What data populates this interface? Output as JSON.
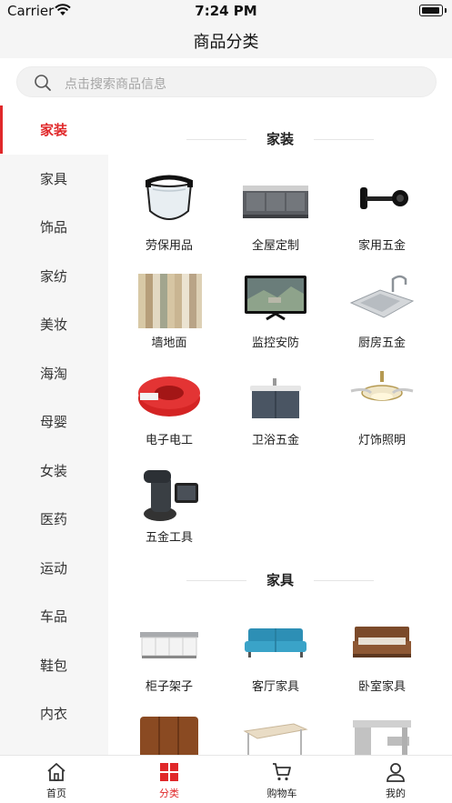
{
  "status_bar": {
    "carrier": "Carrier",
    "time": "7:24 PM"
  },
  "nav": {
    "title": "商品分类"
  },
  "search": {
    "placeholder": "点击搜索商品信息"
  },
  "accent_color": "#e0282a",
  "sidebar": {
    "active_index": 0,
    "items": [
      {
        "label": "家装"
      },
      {
        "label": "家具"
      },
      {
        "label": "饰品"
      },
      {
        "label": "家纺"
      },
      {
        "label": "美妆"
      },
      {
        "label": "海淘"
      },
      {
        "label": "母婴"
      },
      {
        "label": "女装"
      },
      {
        "label": "医药"
      },
      {
        "label": "运动"
      },
      {
        "label": "车品"
      },
      {
        "label": "鞋包"
      },
      {
        "label": "内衣"
      }
    ]
  },
  "sections": [
    {
      "title": "家装",
      "items": [
        {
          "label": "劳保用品",
          "icon": "face-shield-icon"
        },
        {
          "label": "全屋定制",
          "icon": "cabinet-icon"
        },
        {
          "label": "家用五金",
          "icon": "door-stopper-icon"
        },
        {
          "label": "墙地面",
          "icon": "wall-panel-icon"
        },
        {
          "label": "监控安防",
          "icon": "monitor-icon"
        },
        {
          "label": "厨房五金",
          "icon": "kitchen-sink-icon"
        },
        {
          "label": "电子电工",
          "icon": "wire-coil-icon"
        },
        {
          "label": "卫浴五金",
          "icon": "bathroom-vanity-icon"
        },
        {
          "label": "灯饰照明",
          "icon": "ceiling-fan-light-icon"
        },
        {
          "label": "五金工具",
          "icon": "machine-tool-icon"
        }
      ]
    },
    {
      "title": "家具",
      "items": [
        {
          "label": "柜子架子",
          "icon": "kitchen-cabinet-icon"
        },
        {
          "label": "客厅家具",
          "icon": "sofa-icon"
        },
        {
          "label": "卧室家具",
          "icon": "bed-icon"
        },
        {
          "label": "",
          "icon": "wardrobe-icon"
        },
        {
          "label": "",
          "icon": "table-icon"
        },
        {
          "label": "",
          "icon": "desk-icon"
        }
      ]
    }
  ],
  "tabs": [
    {
      "label": "首页",
      "icon": "home-icon"
    },
    {
      "label": "分类",
      "icon": "category-grid-icon"
    },
    {
      "label": "购物车",
      "icon": "cart-icon"
    },
    {
      "label": "我的",
      "icon": "user-icon"
    }
  ],
  "active_tab": 1
}
